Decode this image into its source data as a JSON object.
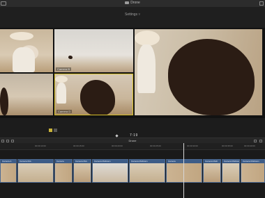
{
  "app": {
    "title": "Drone",
    "settings_label": "Settings ▿"
  },
  "viewer": {
    "angles": [
      {
        "label": ""
      },
      {
        "label": "Camera B"
      },
      {
        "label": ""
      },
      {
        "label": "Camera D"
      }
    ]
  },
  "transport": {
    "timecode": "7:19"
  },
  "timeline": {
    "name": "Drone",
    "ruler": [
      "00:00:10:00",
      "00:00:15:00",
      "00:00:20:00",
      "00:00:25:00",
      "00:00:30:00",
      "00:00:35:00",
      "00:00:40:00"
    ],
    "clips": [
      {
        "label": "Camera A",
        "thumb": "horse"
      },
      {
        "label": "Camera Mul..",
        "thumb": "girl"
      },
      {
        "label": "Camera",
        "thumb": "horse"
      },
      {
        "label": "Camera Mul..",
        "thumb": "horse"
      },
      {
        "label": "Camera Multicam",
        "thumb": "sky"
      },
      {
        "label": "Camera Multicam",
        "thumb": "girl"
      },
      {
        "label": "Camera",
        "thumb": "horse"
      },
      {
        "label": "Camera Multi",
        "thumb": "horse"
      },
      {
        "label": "Camera Multicam",
        "thumb": "girl"
      },
      {
        "label": "Camera Multicam",
        "thumb": "horse"
      }
    ]
  },
  "colors": {
    "accent_yellow": "#d8c12a",
    "clip_blue": "#2e4a6f",
    "clip_label": "#3d5c87"
  },
  "icons": {
    "window": "window-icon",
    "fullscreen": "fullscreen-icon",
    "camera": "camera-icon"
  }
}
